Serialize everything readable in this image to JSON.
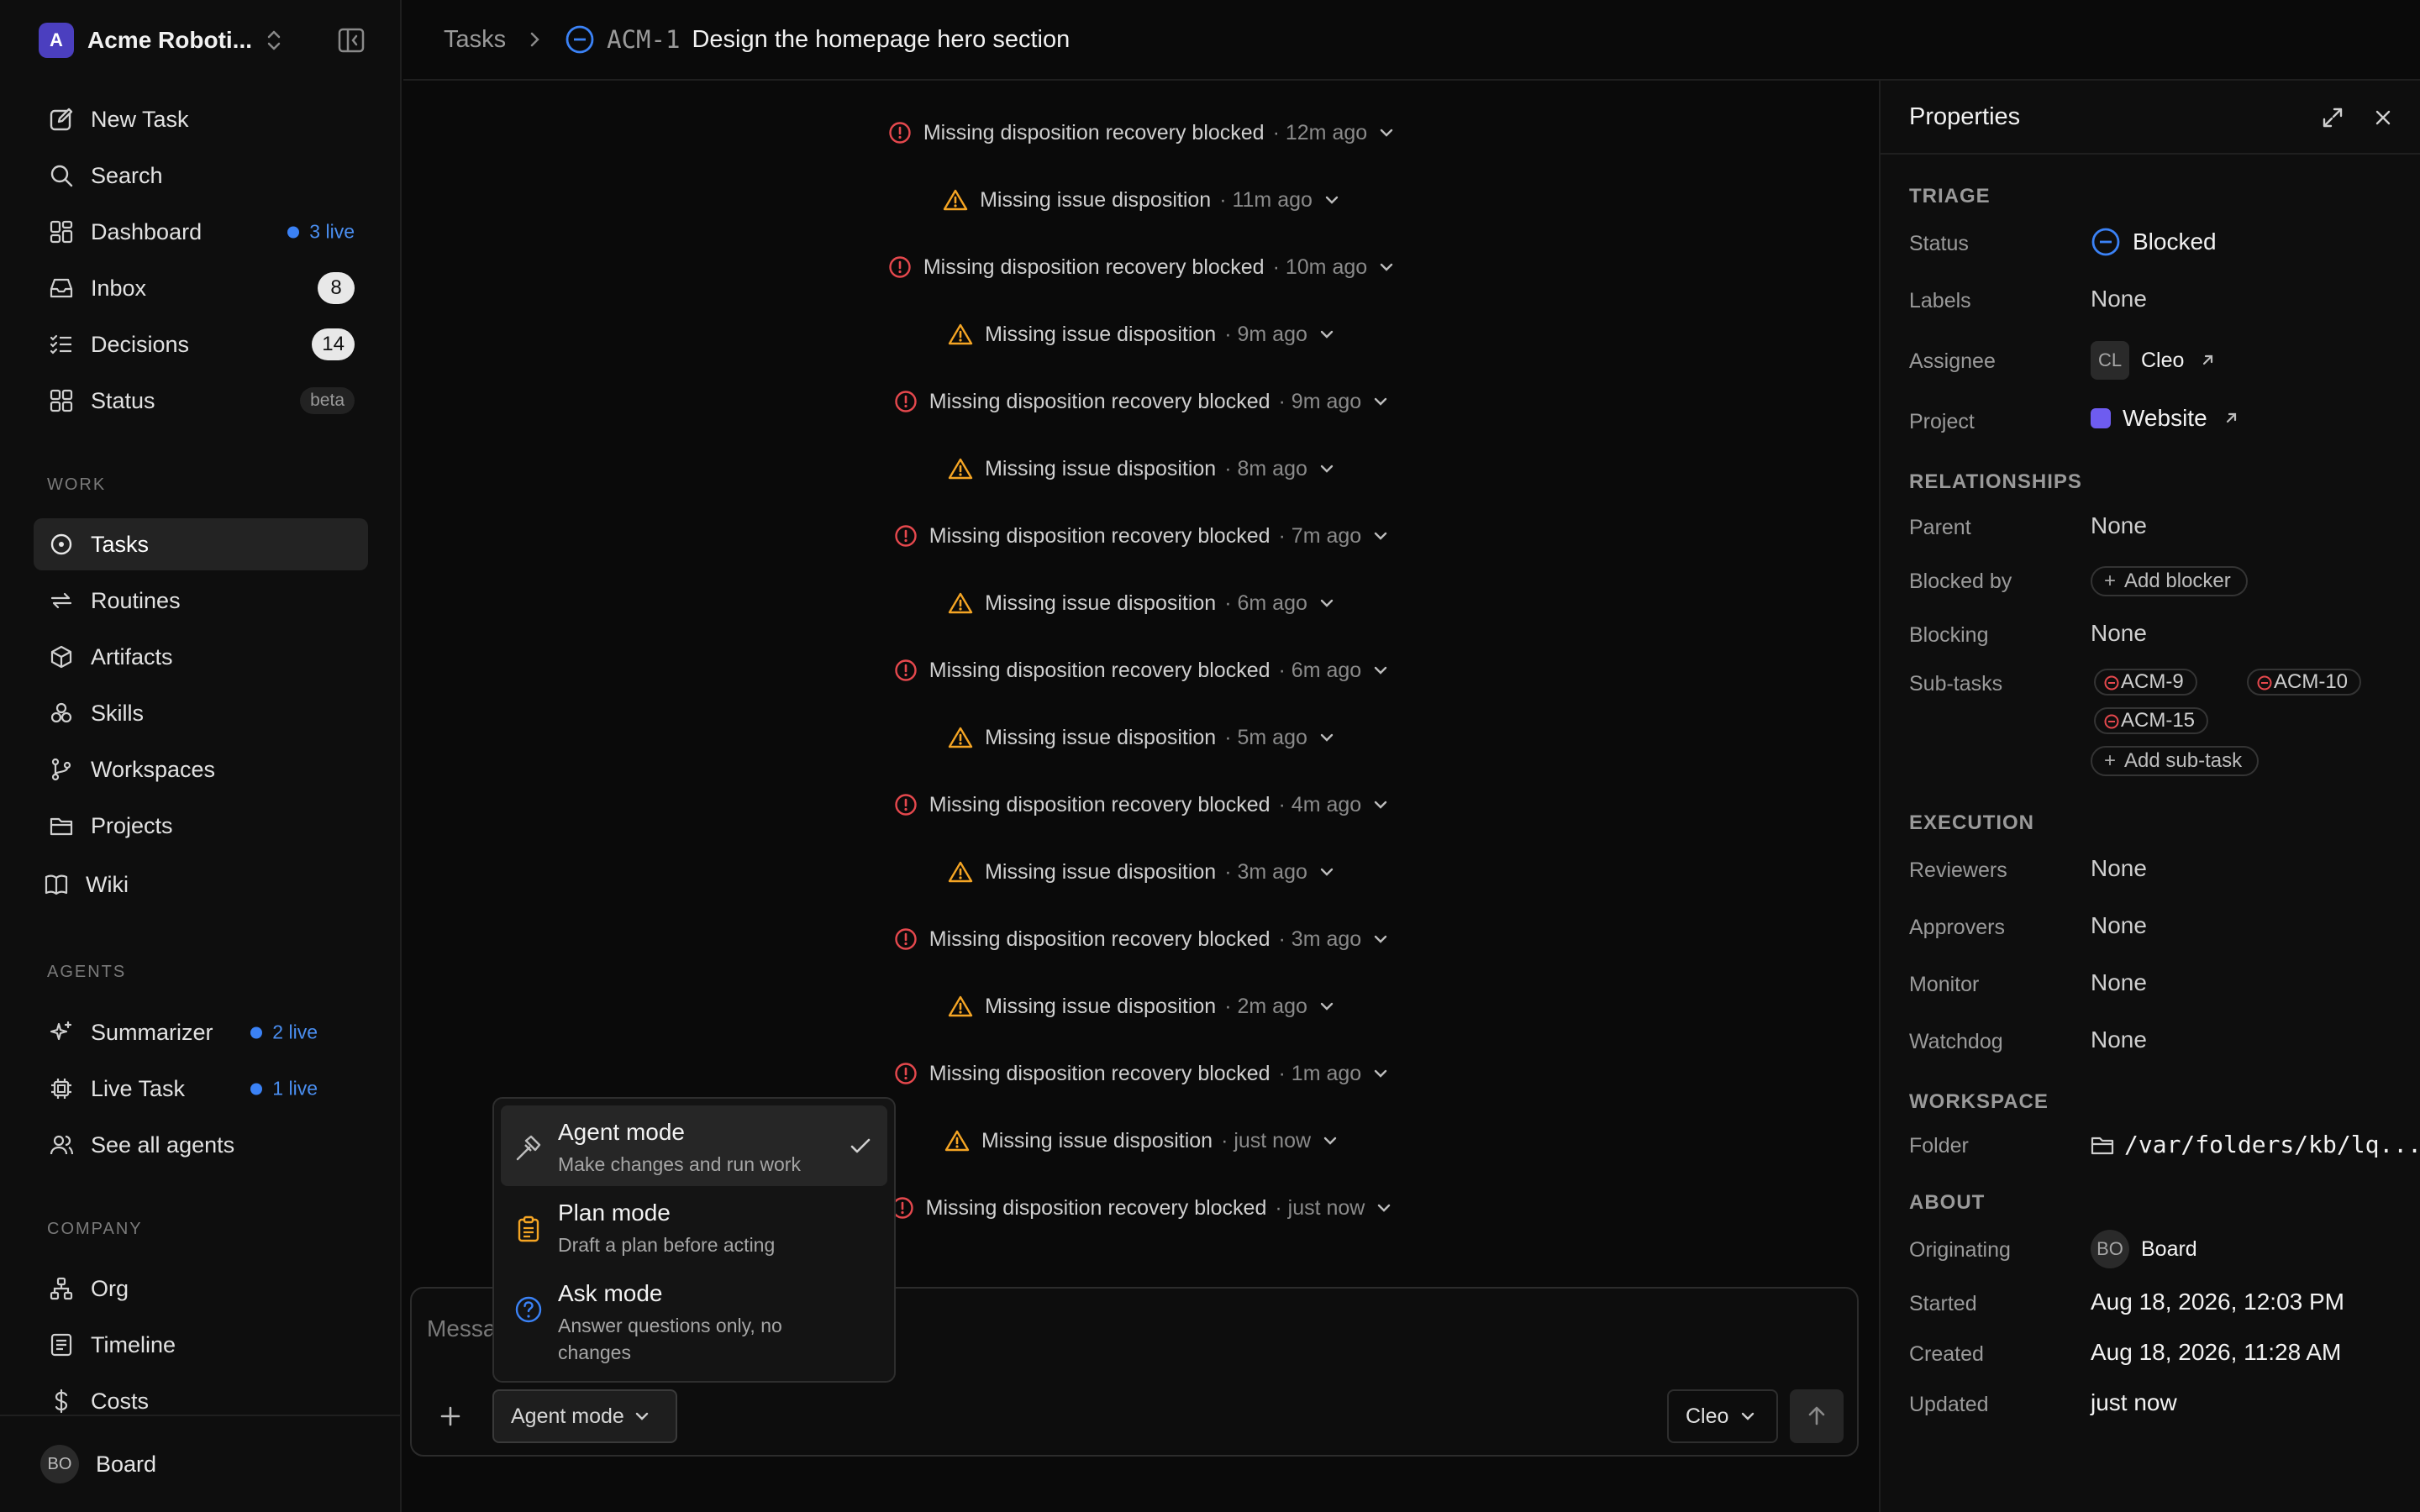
{
  "workspace": {
    "logo_letter": "A",
    "name": "Acme Roboti..."
  },
  "nav": {
    "new_task": "New Task",
    "search": "Search",
    "dashboard": "Dashboard",
    "dashboard_live": "3 live",
    "inbox": "Inbox",
    "inbox_count": "8",
    "decisions": "Decisions",
    "decisions_count": "14",
    "status": "Status",
    "status_badge": "beta"
  },
  "work": {
    "label": "WORK",
    "tasks": "Tasks",
    "routines": "Routines",
    "artifacts": "Artifacts",
    "skills": "Skills",
    "workspaces": "Workspaces",
    "projects": "Projects",
    "wiki": "Wiki"
  },
  "agents": {
    "label": "AGENTS",
    "summarizer": "Summarizer",
    "summarizer_live": "2 live",
    "live_task": "Live Task",
    "live_task_live": "1 live",
    "see_all": "See all agents"
  },
  "company": {
    "label": "COMPANY",
    "org": "Org",
    "timeline": "Timeline",
    "costs": "Costs"
  },
  "footer": {
    "avatar_initials": "BO",
    "name": "Board"
  },
  "breadcrumb": {
    "parent": "Tasks",
    "task_id": "ACM-1",
    "task_title": "Design the homepage hero section"
  },
  "events": [
    {
      "kind": "error",
      "title": "Missing disposition recovery blocked",
      "time": "· 12m ago"
    },
    {
      "kind": "warn",
      "title": "Missing issue disposition",
      "time": "· 11m ago"
    },
    {
      "kind": "error",
      "title": "Missing disposition recovery blocked",
      "time": "· 10m ago"
    },
    {
      "kind": "warn",
      "title": "Missing issue disposition",
      "time": "· 9m ago"
    },
    {
      "kind": "error",
      "title": "Missing disposition recovery blocked",
      "time": "· 9m ago"
    },
    {
      "kind": "warn",
      "title": "Missing issue disposition",
      "time": "· 8m ago"
    },
    {
      "kind": "error",
      "title": "Missing disposition recovery blocked",
      "time": "· 7m ago"
    },
    {
      "kind": "warn",
      "title": "Missing issue disposition",
      "time": "· 6m ago"
    },
    {
      "kind": "error",
      "title": "Missing disposition recovery blocked",
      "time": "· 6m ago"
    },
    {
      "kind": "warn",
      "title": "Missing issue disposition",
      "time": "· 5m ago"
    },
    {
      "kind": "error",
      "title": "Missing disposition recovery blocked",
      "time": "· 4m ago"
    },
    {
      "kind": "warn",
      "title": "Missing issue disposition",
      "time": "· 3m ago"
    },
    {
      "kind": "error",
      "title": "Missing disposition recovery blocked",
      "time": "· 3m ago"
    },
    {
      "kind": "warn",
      "title": "Missing issue disposition",
      "time": "· 2m ago"
    },
    {
      "kind": "error",
      "title": "Missing disposition recovery blocked",
      "time": "· 1m ago"
    },
    {
      "kind": "warn",
      "title": "Missing issue disposition",
      "time": "· just now"
    },
    {
      "kind": "error",
      "title": "Missing disposition recovery blocked",
      "time": "· just now"
    }
  ],
  "composer": {
    "placeholder": "Message the agent or mention someone...",
    "mode_button": "Agent mode",
    "agent_button": "Cleo"
  },
  "mode_menu": {
    "agent_label": "Agent mode",
    "agent_desc": "Make changes and run work",
    "plan_label": "Plan mode",
    "plan_desc": "Draft a plan before acting",
    "ask_label": "Ask mode",
    "ask_desc_1": "Answer questions only, no",
    "ask_desc_2": "changes"
  },
  "properties": {
    "title": "Properties",
    "triage": {
      "heading": "TRIAGE",
      "status_label": "Status",
      "status_value": "Blocked",
      "labels_label": "Labels",
      "labels_value": "None",
      "assignee_label": "Assignee",
      "assignee_initials": "CL",
      "assignee_value": "Cleo",
      "project_label": "Project",
      "project_value": "Website"
    },
    "relationships": {
      "heading": "RELATIONSHIPS",
      "parent_label": "Parent",
      "parent_value": "None",
      "blocked_by_label": "Blocked by",
      "add_blocker": "Add blocker",
      "blocking_label": "Blocking",
      "blocking_value": "None",
      "subtasks_label": "Sub-tasks",
      "subtasks": [
        "ACM-9",
        "ACM-10",
        "ACM-15"
      ],
      "add_subtask": "Add sub-task"
    },
    "execution": {
      "heading": "EXECUTION",
      "reviewers_label": "Reviewers",
      "reviewers_value": "None",
      "approvers_label": "Approvers",
      "approvers_value": "None",
      "monitor_label": "Monitor",
      "monitor_value": "None",
      "watchdog_label": "Watchdog",
      "watchdog_value": "None"
    },
    "workspace": {
      "heading": "WORKSPACE",
      "folder_label": "Folder",
      "folder_value": "/var/folders/kb/lq..."
    },
    "about": {
      "heading": "ABOUT",
      "originating_label": "Originating",
      "originating_initials": "BO",
      "originating_value": "Board",
      "started_label": "Started",
      "started_value": "Aug 18, 2026, 12:03 PM",
      "created_label": "Created",
      "created_value": "Aug 18, 2026, 11:28 AM",
      "updated_label": "Updated",
      "updated_value": "just now"
    }
  },
  "colors": {
    "accent_blue": "#3b82f6",
    "error_red": "#e5484d",
    "warn_amber": "#f5a524",
    "project_purple": "#6e5cf0"
  }
}
